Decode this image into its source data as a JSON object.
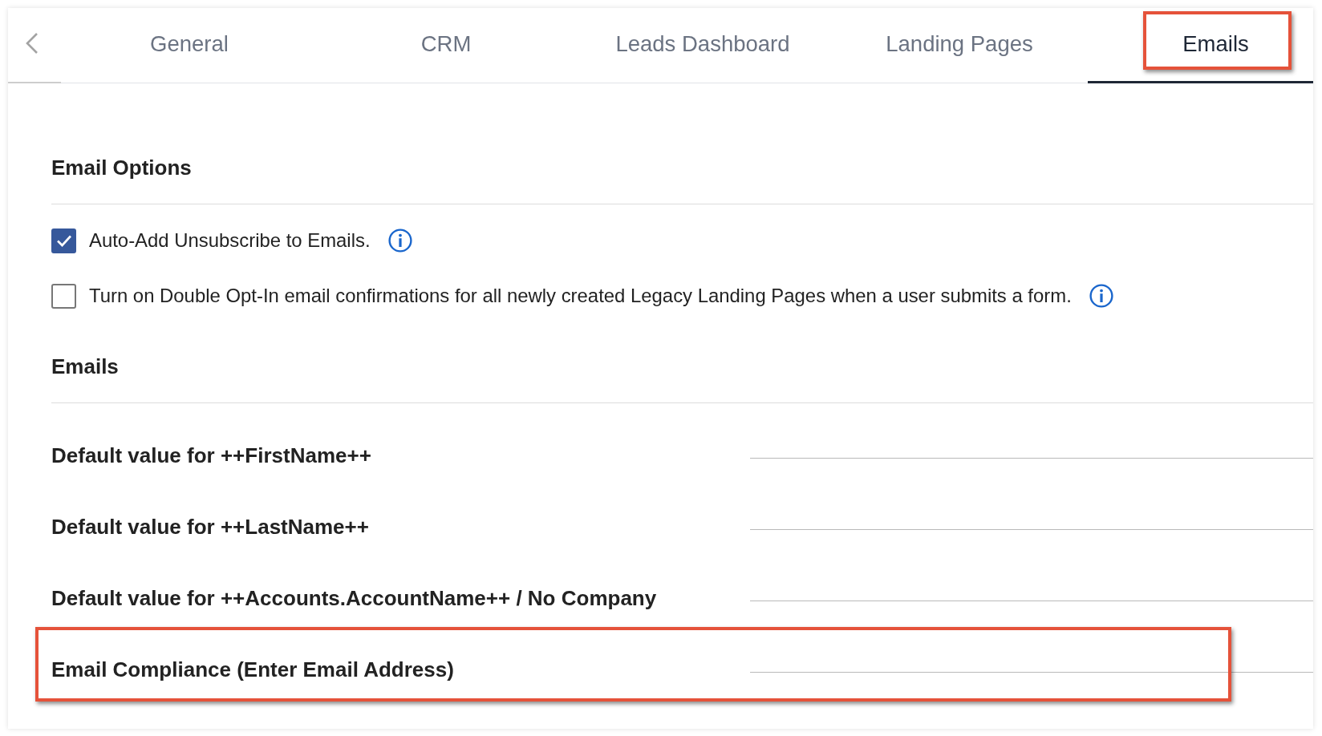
{
  "tabs": [
    {
      "label": "General",
      "selected": false,
      "highlighted": false
    },
    {
      "label": "CRM",
      "selected": false,
      "highlighted": false
    },
    {
      "label": "Leads Dashboard",
      "selected": false,
      "highlighted": false
    },
    {
      "label": "Landing Pages",
      "selected": false,
      "highlighted": false
    },
    {
      "label": "Emails",
      "selected": true,
      "highlighted": true
    }
  ],
  "email_options": {
    "title": "Email Options",
    "options": [
      {
        "label": "Auto-Add Unsubscribe to Emails.",
        "checked": true
      },
      {
        "label": "Turn on Double Opt-In email confirmations for all newly created Legacy Landing Pages when a user submits a form.",
        "checked": false
      }
    ]
  },
  "emails": {
    "title": "Emails",
    "fields": [
      {
        "label": "Default value for ++FirstName++",
        "highlighted": false
      },
      {
        "label": "Default value for ++LastName++",
        "highlighted": false
      },
      {
        "label": "Default value for ++Accounts.AccountName++ / No Company",
        "highlighted": false
      },
      {
        "label": "Email Compliance (Enter Email Address)",
        "highlighted": true
      }
    ]
  }
}
